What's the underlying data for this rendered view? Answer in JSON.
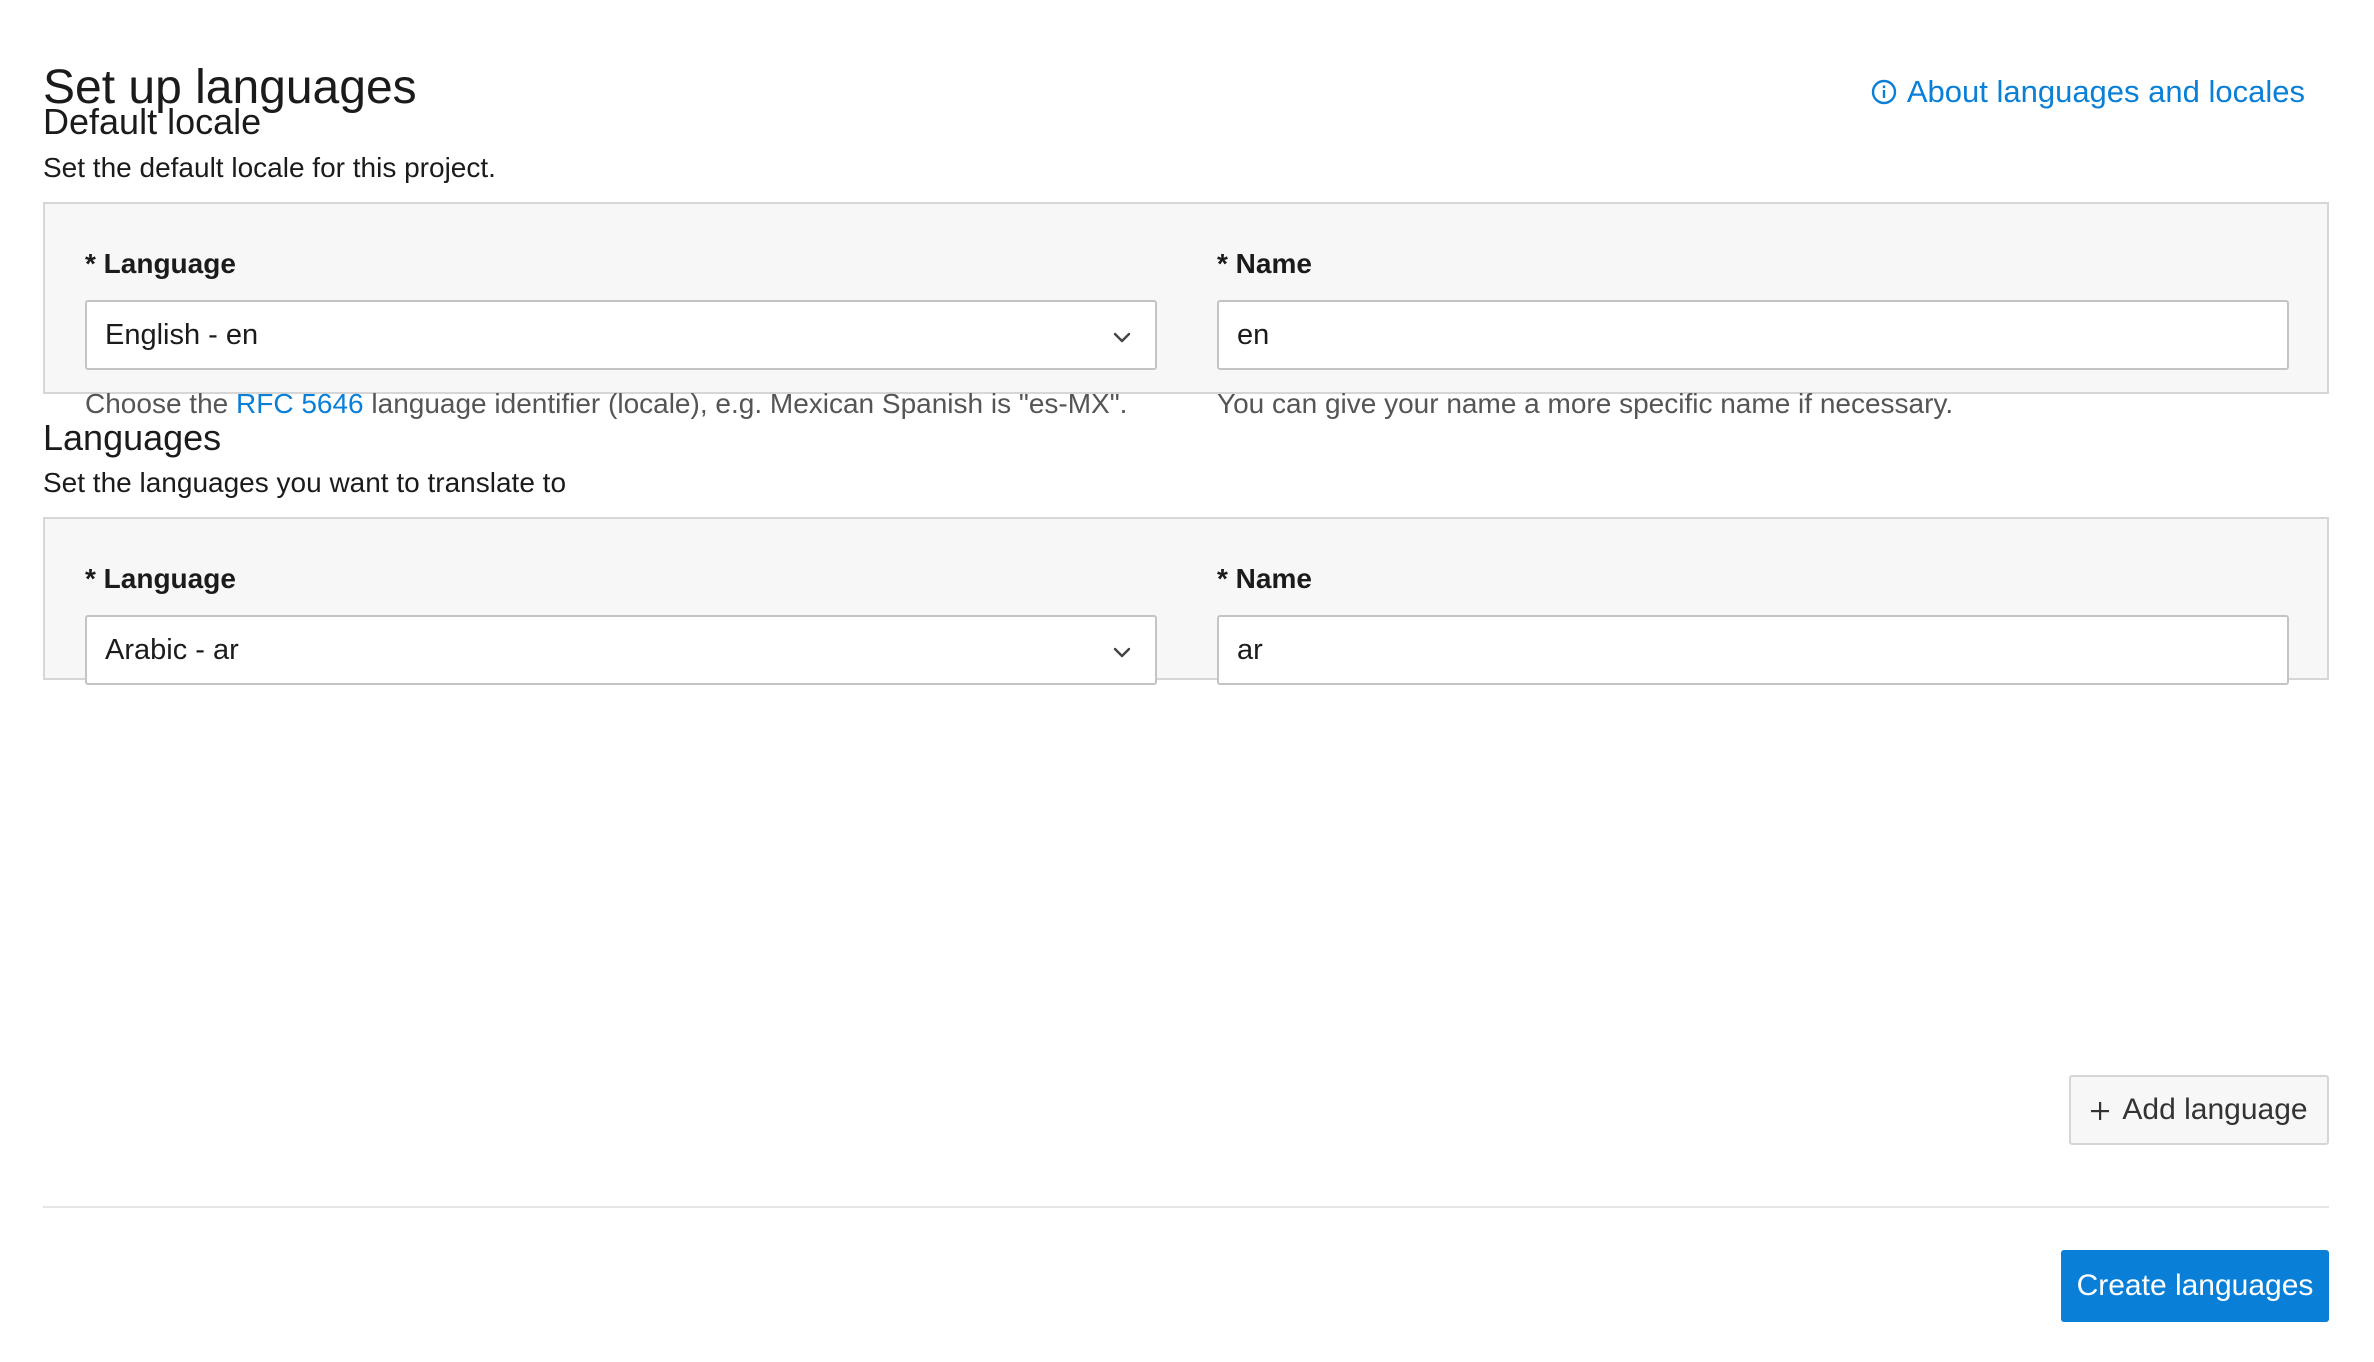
{
  "header": {
    "title": "Set up languages",
    "about_link": "About languages and locales"
  },
  "default_locale": {
    "title": "Default locale",
    "description": "Set the default locale for this project.",
    "language_label": "* Language",
    "language_value": "English - en",
    "language_help_before": "Choose the ",
    "language_help_link": "RFC 5646",
    "language_help_after": " language identifier (locale), e.g. Mexican Spanish is \"es-MX\".",
    "name_label": "* Name",
    "name_value": "en",
    "name_help": "You can give your name a more specific name if necessary."
  },
  "languages": {
    "title": "Languages",
    "description": "Set the languages you want to translate to",
    "items": [
      {
        "language_label": "* Language",
        "language_value": "Arabic - ar",
        "name_label": "* Name",
        "name_value": "ar"
      }
    ],
    "add_button": "Add language"
  },
  "footer": {
    "create_button": "Create languages"
  },
  "colors": {
    "accent": "#0a7fd8",
    "panel_background": "#f7f7f7",
    "panel_border": "#d6d6d6"
  },
  "icons": {
    "about": "info-circle-icon",
    "select": "chevron-down-icon",
    "add": "plus-icon"
  }
}
